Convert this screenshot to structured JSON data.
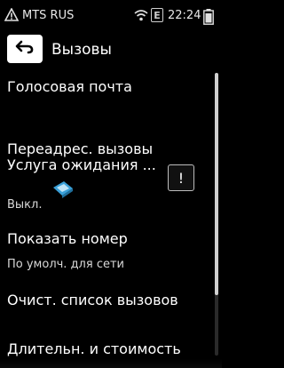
{
  "status_bar": {
    "carrier": "MTS RUS",
    "network_badge": "E",
    "time": "22:24",
    "icons": [
      "warning-icon",
      "wifi-icon",
      "battery-icon"
    ]
  },
  "header": {
    "title": "Вызовы",
    "back_icon": "back-arrow-icon"
  },
  "menu": {
    "items": [
      {
        "label": "Голосовая почта"
      },
      {
        "label": "Переадрес. вызовы"
      },
      {
        "label": "Услуга ожидания ...",
        "sublabel": "Выкл.",
        "toggle_glyph": "!"
      },
      {
        "label": "Показать номер",
        "sublabel": "По умолч. для сети"
      },
      {
        "label": "Очист. список вызовов"
      },
      {
        "label": "Длительн. и стоимость"
      }
    ]
  },
  "colors": {
    "background": "#000000",
    "text": "#ffffff",
    "cursor": "#3aa0d8"
  }
}
